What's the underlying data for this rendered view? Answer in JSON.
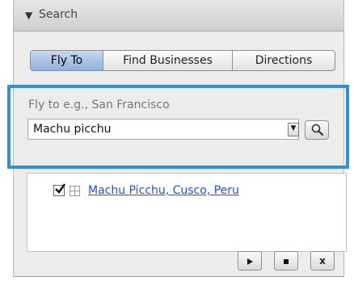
{
  "panel": {
    "header_arrow": "▼",
    "header_title": "Search",
    "tabs": [
      {
        "label": "Fly To",
        "active": true
      },
      {
        "label": "Find Businesses",
        "active": false
      },
      {
        "label": "Directions",
        "active": false
      }
    ],
    "fly_to": {
      "hint": "Fly to e.g., San Francisco",
      "input_value": "Machu picchu"
    },
    "results": [
      {
        "label": "Machu Picchu, Cusco, Peru",
        "checked": true
      }
    ],
    "controls": {
      "play_icon": "play-icon",
      "stop_icon": "stop-icon",
      "close_label": "x"
    },
    "colors": {
      "highlight": "#2e8fdc",
      "active_tab": "#8fb0dc",
      "link": "#1a55c9"
    }
  }
}
